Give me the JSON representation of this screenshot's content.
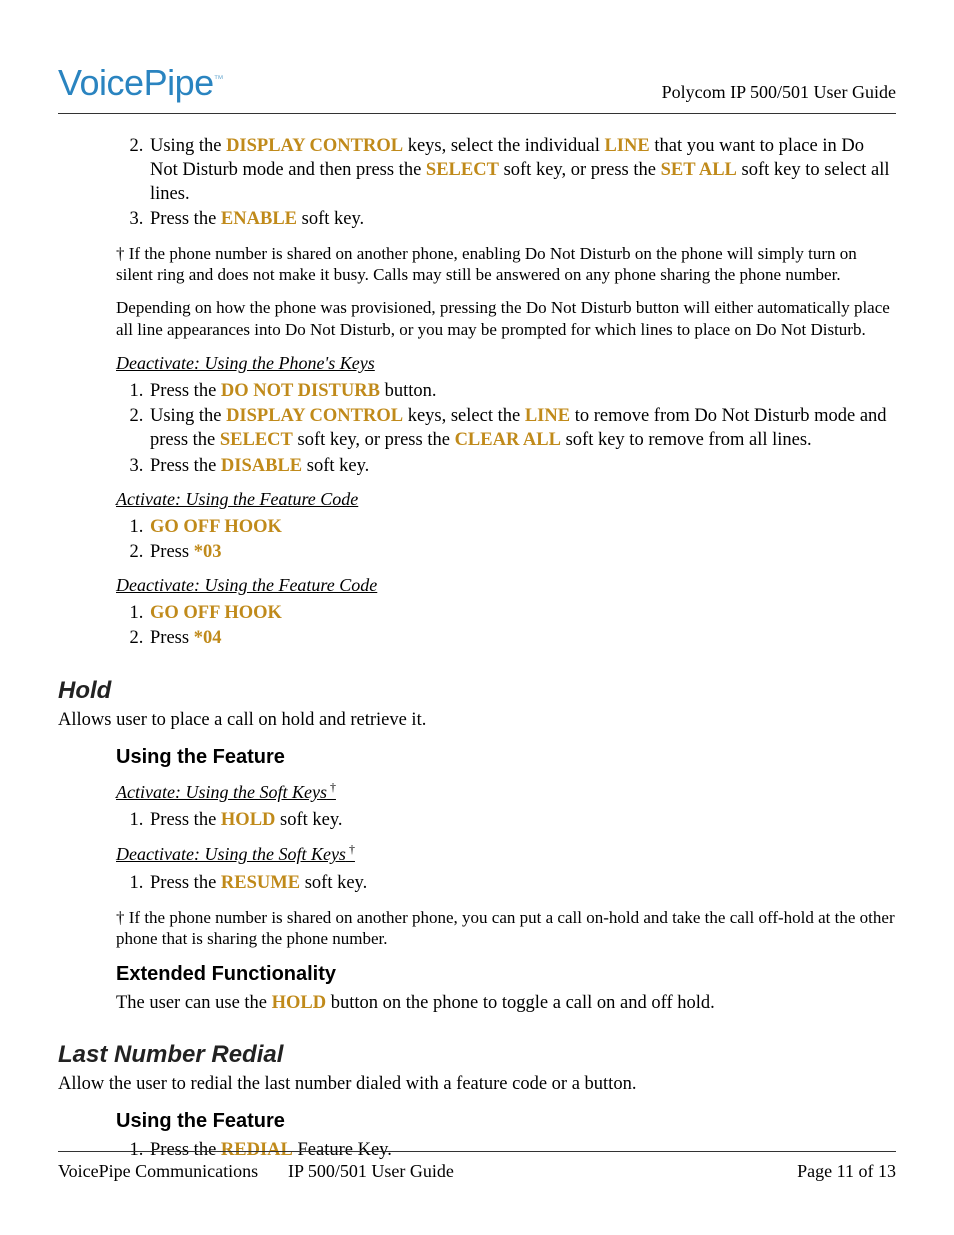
{
  "header": {
    "logo_text": "VoicePipe",
    "logo_tm": "™",
    "right": "Polycom IP 500/501 User Guide"
  },
  "dnd_continue": {
    "item2_a": "Using the ",
    "item2_k1": "DISPLAY CONTROL",
    "item2_b": " keys, select the individual ",
    "item2_k2": "LINE",
    "item2_c": " that you want to place in Do Not Disturb mode and then press the ",
    "item2_k3": "SELECT",
    "item2_d": " soft key, or press the ",
    "item2_k4": "SET ALL",
    "item2_e": " soft key to select all lines.",
    "item3_a": "Press the ",
    "item3_k1": "ENABLE",
    "item3_b": " soft key."
  },
  "note1": "† If the phone number is shared on another phone, enabling Do Not Disturb on the phone will simply turn on silent ring and does not make it busy.  Calls may still be answered on any phone sharing the phone number.",
  "note2": "Depending on how the phone was provisioned, pressing the Do Not Disturb button will either automatically place all line appearances into Do Not Disturb, or you may be prompted for which lines to place on Do Not Disturb.",
  "deact_keys": {
    "title": "Deactivate: Using the Phone's Keys",
    "i1_a": "Press the ",
    "i1_k": "DO NOT DISTURB",
    "i1_b": " button.",
    "i2_a": "Using the ",
    "i2_k1": "DISPLAY CONTROL",
    "i2_b": " keys, select the ",
    "i2_k2": "LINE",
    "i2_c": " to remove from Do Not Disturb mode and press the ",
    "i2_k3": "SELECT",
    "i2_d": " soft key, or press the ",
    "i2_k4": "CLEAR ALL",
    "i2_e": " soft key to remove from all lines.",
    "i3_a": "Press the ",
    "i3_k": "DISABLE",
    "i3_b": " soft key."
  },
  "act_code": {
    "title": "Activate: Using the Feature Code",
    "i1": "GO OFF HOOK",
    "i2_a": "Press ",
    "i2_k": "*03"
  },
  "deact_code": {
    "title": "Deactivate: Using the Feature Code",
    "i1": "GO OFF HOOK",
    "i2_a": "Press ",
    "i2_k": "*04"
  },
  "hold": {
    "title": "Hold",
    "intro": "Allows user to place a call on hold and retrieve it.",
    "using": "Using the Feature",
    "act_title": "Activate: Using the Soft Keys",
    "act_sup": " †",
    "act_i1_a": "Press the ",
    "act_i1_k": "HOLD",
    "act_i1_b": " soft key.",
    "deact_title": "Deactivate: Using the Soft Keys",
    "deact_sup": " †",
    "deact_i1_a": "Press the ",
    "deact_i1_k": "RESUME",
    "deact_i1_b": " soft key.",
    "note": "† If the phone number is shared on another phone, you can put a call on-hold and take the call off-hold at the other phone that is sharing the phone number.",
    "ext_title": "Extended Functionality",
    "ext_a": "The user can use the ",
    "ext_k": "HOLD",
    "ext_b": " button on the phone to toggle a call on and off hold."
  },
  "redial": {
    "title": "Last Number Redial",
    "intro": "Allow the user to redial the last number dialed with a feature code or a button.",
    "using": "Using the Feature",
    "i1_a": "Press the ",
    "i1_k": "REDIAL",
    "i1_b": " Feature Key."
  },
  "footer": {
    "left": "VoicePipe Communications",
    "center": "IP 500/501 User Guide",
    "right": "Page 11 of 13"
  }
}
